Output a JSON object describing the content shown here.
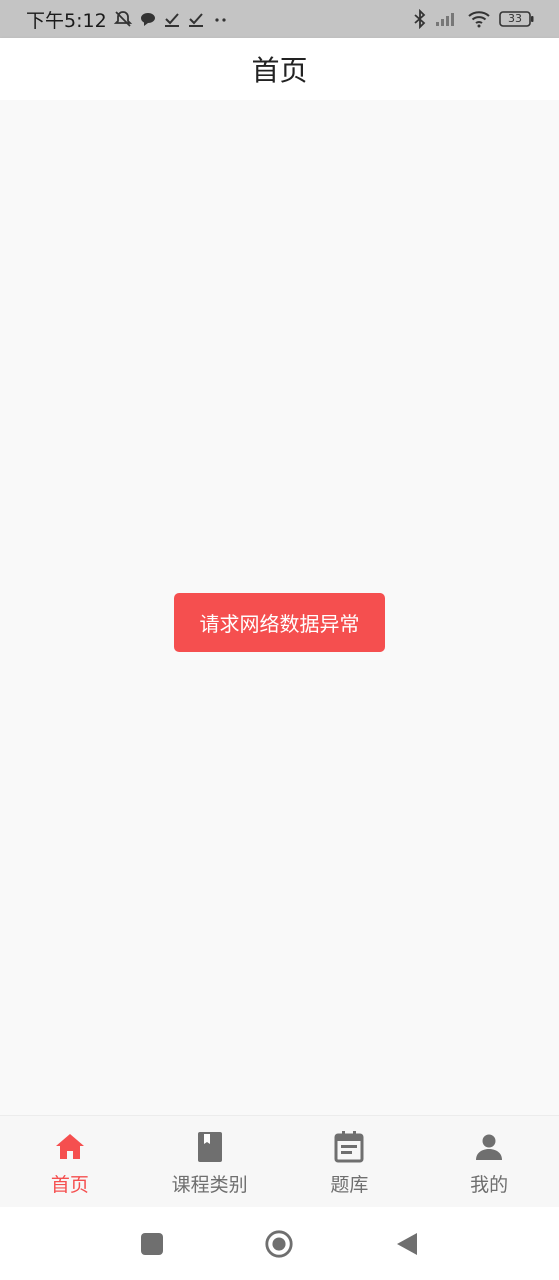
{
  "status_bar": {
    "time": "下午5:12",
    "battery": "33"
  },
  "header": {
    "title": "首页"
  },
  "toast": {
    "message": "请求网络数据异常"
  },
  "tabs": [
    {
      "label": "首页",
      "icon": "home-icon",
      "active": true
    },
    {
      "label": "课程类别",
      "icon": "book-icon",
      "active": false
    },
    {
      "label": "题库",
      "icon": "calendar-icon",
      "active": false
    },
    {
      "label": "我的",
      "icon": "person-icon",
      "active": false
    }
  ],
  "colors": {
    "accent": "#f54f4f",
    "tab_inactive": "#6f6f6f",
    "status_bar_bg": "#c4c4c4"
  }
}
